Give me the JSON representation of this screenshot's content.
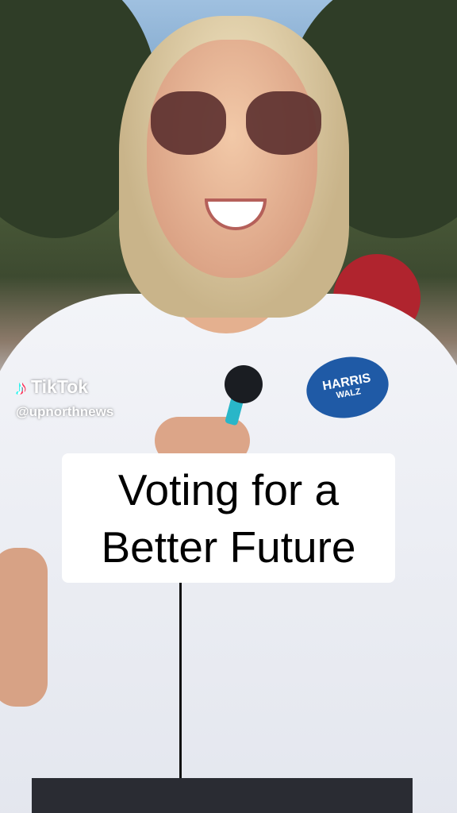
{
  "watermark": {
    "brand": "TikTok",
    "handle": "@upnorthnews",
    "icon": "tiktok-note-icon"
  },
  "caption": {
    "line1": "Voting for a",
    "line2": "Better Future"
  },
  "scene": {
    "badge_line1": "HARRIS",
    "badge_line2": "WALZ",
    "colors": {
      "badge": "#1f5aa6",
      "mic": "#29b6c8",
      "caption_bg": "#ffffff"
    }
  }
}
